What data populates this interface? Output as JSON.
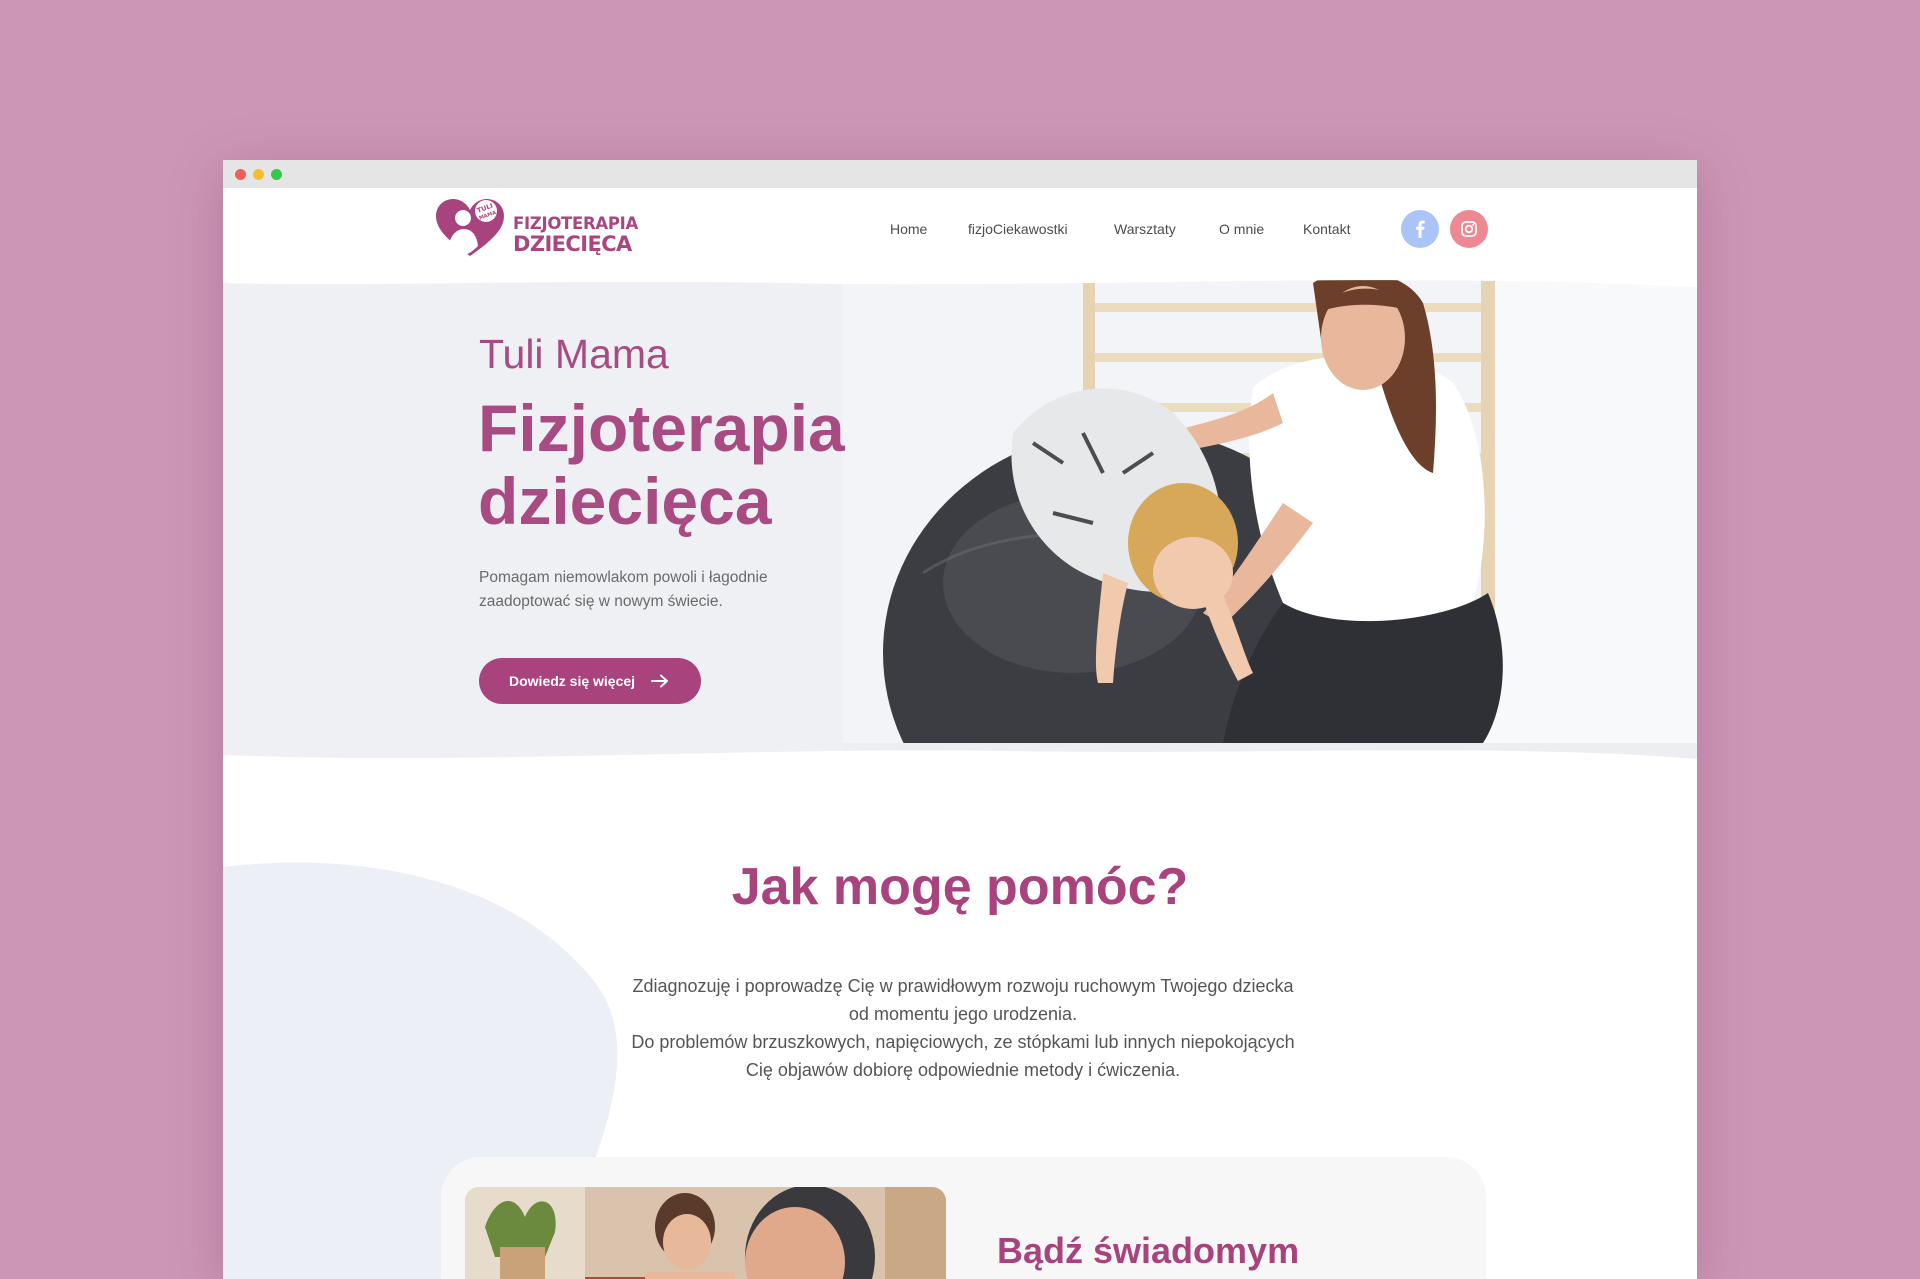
{
  "colors": {
    "page_background": "#cc97b6",
    "brand": "#a8437e",
    "facebook_button": "#aac4f5",
    "instagram_button": "#ee8994",
    "hero_background": "#ebedf3",
    "card_background": "#f7f7f8"
  },
  "logo": {
    "badge_text": "TULI MAMA",
    "line1": "FIZJOTERAPIA",
    "line2": "DZIECIĘCA"
  },
  "nav": {
    "items": [
      {
        "label": "Home"
      },
      {
        "label": "fizjoCiekawostki"
      },
      {
        "label": "Warsztaty"
      },
      {
        "label": "O mnie"
      },
      {
        "label": "Kontakt"
      }
    ],
    "social": [
      {
        "icon": "facebook-icon"
      },
      {
        "icon": "instagram-icon"
      }
    ]
  },
  "hero": {
    "subtitle": "Tuli Mama",
    "title_line1": "Fizjoterapia",
    "title_line2": "dziecięca",
    "text": "Pomagam niemowlakom powoli i łagodnie zaadoptować się w nowym świecie.",
    "button_label": "Dowiedz się więcej",
    "button_icon": "arrow-right-icon"
  },
  "help": {
    "heading": "Jak mogę pomóc?",
    "lines": [
      "Zdiagnozuję i poprowadzę Cię w prawidłowym rozwoju ruchowym Twojego dziecka",
      "od momentu jego urodzenia.",
      "Do problemów brzuszkowych, napięciowych, ze stópkami lub innych niepokojących",
      "Cię objawów dobiorę odpowiednie metody i ćwiczenia."
    ]
  },
  "card": {
    "heading": "Bądź świadomym"
  }
}
